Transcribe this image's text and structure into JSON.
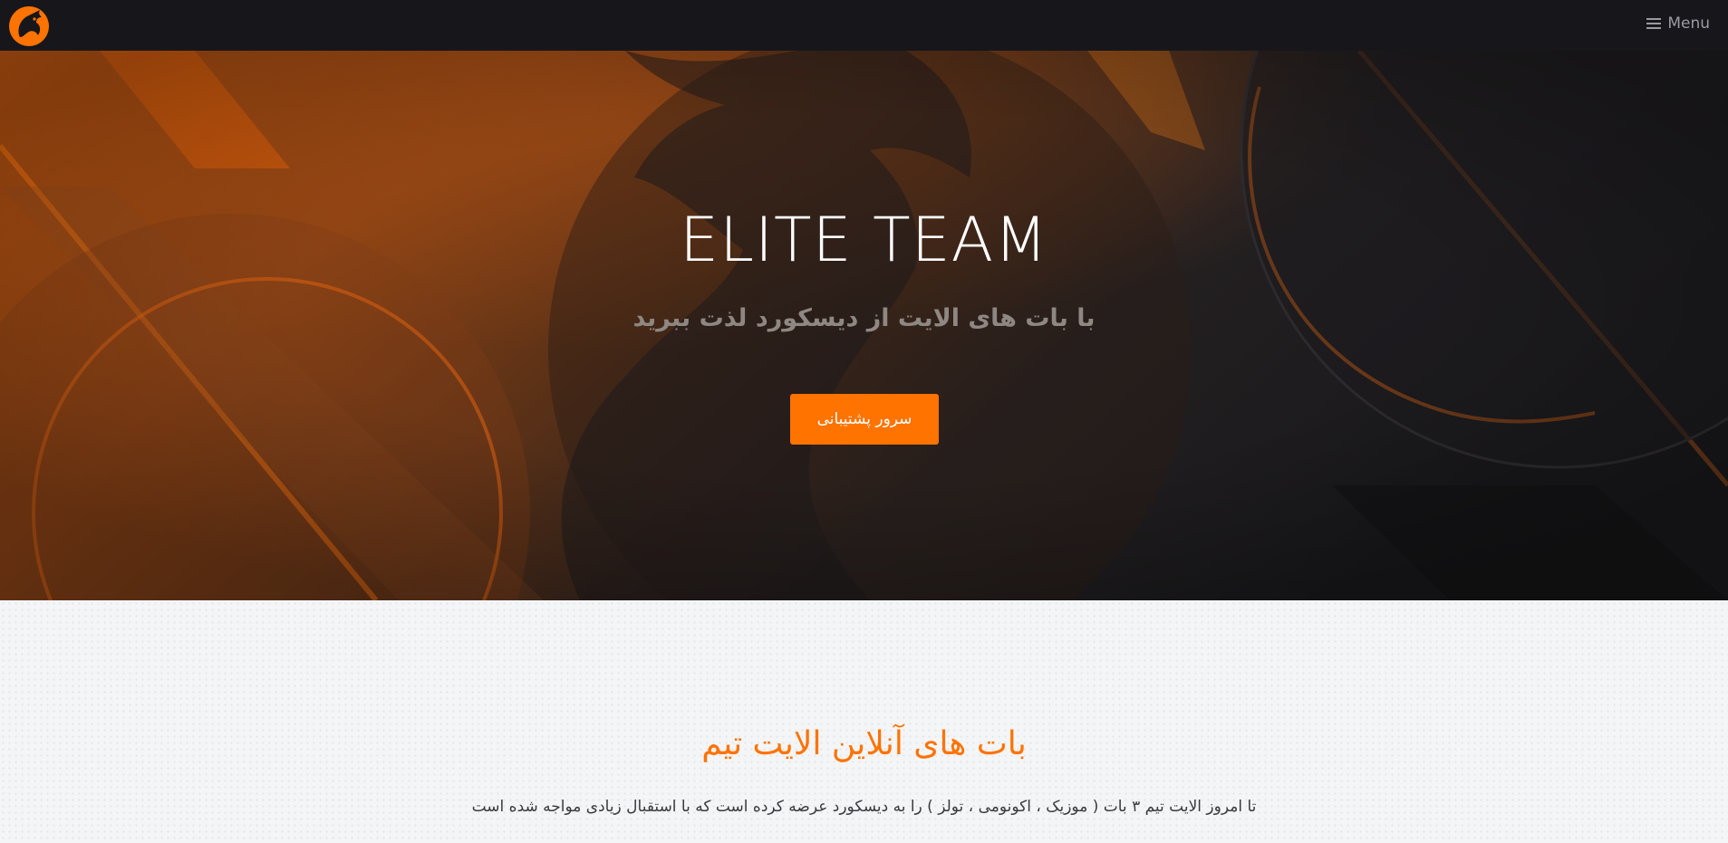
{
  "navbar": {
    "logo_icon": "dragon-logo-icon",
    "menu_icon": "hamburger-icon",
    "menu_label": "Menu"
  },
  "hero": {
    "title": "ELITE TEAM",
    "subtitle": "با بات های الایت از دیسکورد لذت ببرید",
    "button_label": "سرور پشتیبانی"
  },
  "section": {
    "title": "بات های آنلاین الایت تیم",
    "text": "تا امروز الایت تیم ۳ بات ( موزیک ، اکونومی ، تولز ) را به دیسکورد عرضه کرده است که با استقبال زیادی مواجه شده است"
  },
  "colors": {
    "accent": "#ff7300",
    "navbar_bg": "#17171b",
    "hero_dark": "#1a1a1d",
    "section_bg": "#f4f5f7"
  }
}
